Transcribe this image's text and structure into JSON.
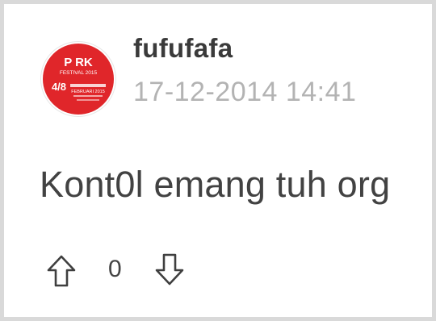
{
  "post": {
    "username": "fufufafa",
    "timestamp": "17-12-2014 14:41",
    "comment": "Kont0l emang tuh org"
  },
  "avatar": {
    "description_icon": "festival-logo-avatar",
    "brand_color": "#e0262a",
    "logo_text_top": "P RK",
    "logo_text_festival": "FESTIVAL 2015",
    "logo_text_date": "4/8",
    "logo_text_month": "FEBRUARI 2015"
  },
  "votes": {
    "upvote_icon": "arrow-up-icon",
    "count": "0",
    "downvote_icon": "arrow-down-icon"
  },
  "colors": {
    "username": "#3a3a3a",
    "timestamp": "#b3b3b3",
    "comment": "#424242",
    "border": "#d9d9d9"
  }
}
